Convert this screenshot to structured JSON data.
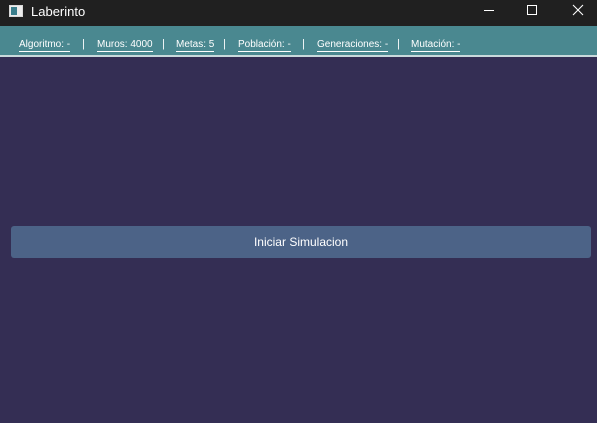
{
  "window": {
    "title": "Laberinto",
    "icon": "window-app-icon",
    "controls": [
      "minimize-icon",
      "maximize-icon",
      "close-icon"
    ]
  },
  "menubar": {
    "items": [
      {
        "label": "Algoritmo: -"
      },
      {
        "label": "Muros: 4000"
      },
      {
        "label": "Metas: 5"
      },
      {
        "label": "Población: -"
      },
      {
        "label": "Generaciones: -"
      },
      {
        "label": "Mutación: -"
      }
    ],
    "separator": "|"
  },
  "main": {
    "start_button_label": "Iniciar Simulacion"
  },
  "colors": {
    "background": "#342e54",
    "titlebar": "#202020",
    "menubar": "#4a8890",
    "button": "#4c6387"
  }
}
